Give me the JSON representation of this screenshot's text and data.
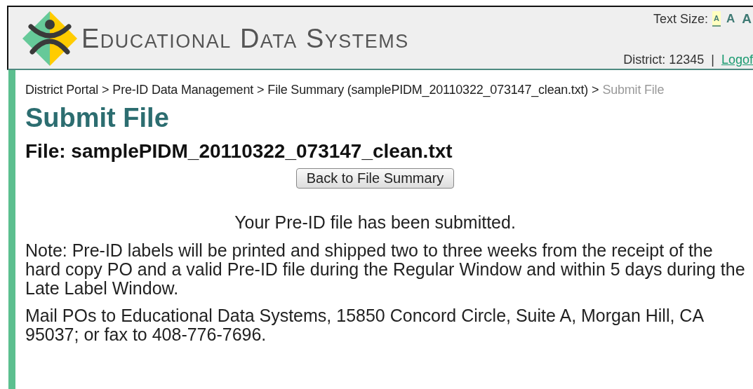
{
  "header": {
    "logo_text": "Educational Data Systems",
    "text_size": {
      "label": "Text Size:",
      "options": [
        {
          "label": "A",
          "selected": true
        },
        {
          "label": "A",
          "selected": false
        },
        {
          "label": "A",
          "selected": false
        }
      ]
    },
    "district": "District: 12345",
    "divider": "|",
    "logoff": "Logof"
  },
  "breadcrumb": [
    {
      "label": "District Portal",
      "kind": "link"
    },
    {
      "label": ">",
      "kind": "separator"
    },
    {
      "label": "Pre-ID Data Management",
      "kind": "link"
    },
    {
      "label": ">",
      "kind": "separator"
    },
    {
      "label": "File Summary (samplePIDM_20110322_073147_clean.txt)",
      "kind": "link"
    },
    {
      "label": ">",
      "kind": "separator"
    },
    {
      "label": "Submit File",
      "kind": "current"
    }
  ],
  "title": "Submit File",
  "file_heading": "File: samplePIDM_20110322_073147_clean.txt",
  "back_button": "Back to File Summary",
  "confirmation": "Your Pre-ID file has been submitted.",
  "paragraphs": [
    "Note: Pre-ID labels will be printed and shipped two to three weeks from the receipt of the hard copy PO and a valid Pre-ID file during the Regular Window and within 5 days during the Late Label Window.",
    "Mail POs to Educational Data Systems, 15850 Concord Circle, Suite A, Morgan Hill, CA 95037; or fax to 408-776-7696."
  ]
}
